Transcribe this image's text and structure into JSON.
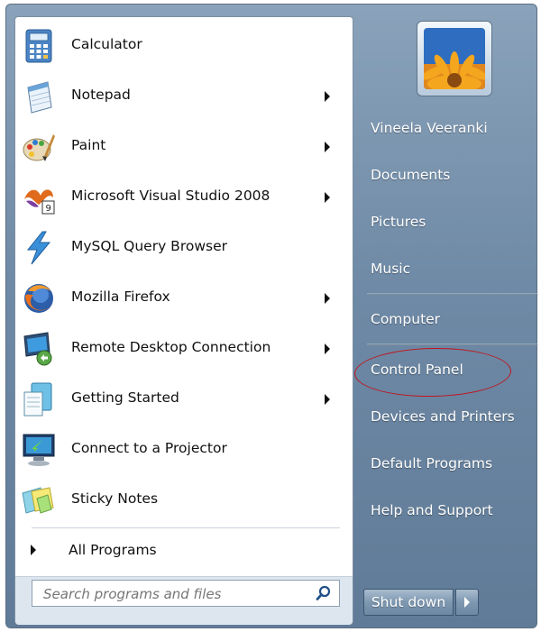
{
  "programs": [
    {
      "label": "Calculator",
      "icon": "calculator-icon",
      "has_submenu": false
    },
    {
      "label": "Notepad",
      "icon": "notepad-icon",
      "has_submenu": true
    },
    {
      "label": "Paint",
      "icon": "paint-icon",
      "has_submenu": true
    },
    {
      "label": "Microsoft Visual Studio 2008",
      "icon": "visual-studio-icon",
      "has_submenu": true
    },
    {
      "label": "MySQL Query Browser",
      "icon": "mysql-icon",
      "has_submenu": false
    },
    {
      "label": "Mozilla Firefox",
      "icon": "firefox-icon",
      "has_submenu": true
    },
    {
      "label": "Remote Desktop Connection",
      "icon": "remote-desktop-icon",
      "has_submenu": true
    },
    {
      "label": "Getting Started",
      "icon": "getting-started-icon",
      "has_submenu": true
    },
    {
      "label": "Connect to a Projector",
      "icon": "projector-icon",
      "has_submenu": false
    },
    {
      "label": "Sticky Notes",
      "icon": "sticky-notes-icon",
      "has_submenu": false
    }
  ],
  "all_programs": {
    "label": "All Programs"
  },
  "search": {
    "placeholder": "Search programs and files"
  },
  "right_links": {
    "user": "Vineela Veeranki",
    "documents": "Documents",
    "pictures": "Pictures",
    "music": "Music",
    "computer": "Computer",
    "control_panel": "Control Panel",
    "devices": "Devices and Printers",
    "default_programs": "Default Programs",
    "help": "Help and Support"
  },
  "shutdown": {
    "label": "Shut down"
  },
  "colors": {
    "highlight_ellipse": "#c0141c",
    "right_pane": "#6f8aa6"
  }
}
